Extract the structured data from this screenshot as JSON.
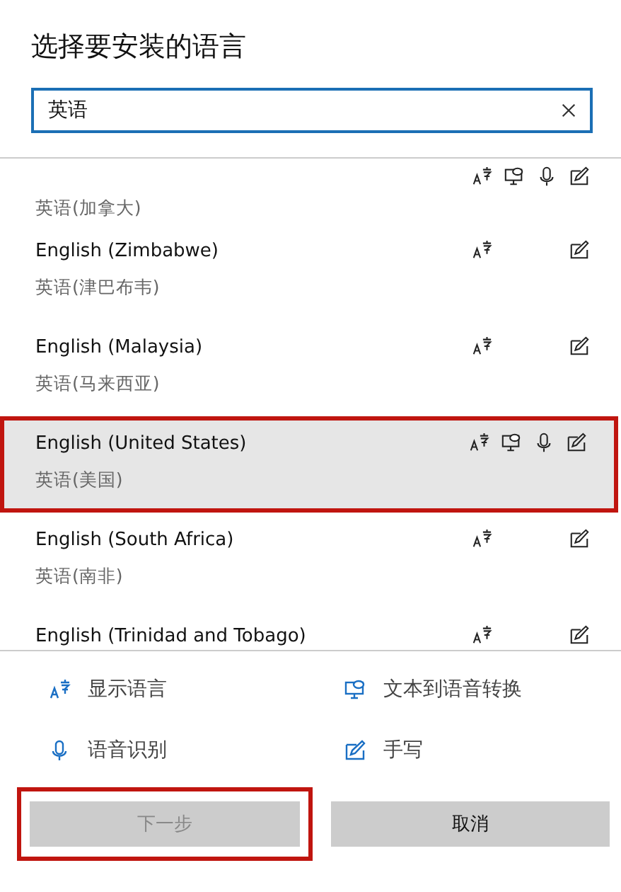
{
  "title": "选择要安装的语言",
  "search": {
    "value": "英语"
  },
  "languages": [
    {
      "native": "英语(加拿大)",
      "display": true,
      "tts": true,
      "speech": true,
      "handwriting": true,
      "selected": false
    },
    {
      "name": "English (Zimbabwe)",
      "native": "英语(津巴布韦)",
      "display": true,
      "tts": false,
      "speech": false,
      "handwriting": true,
      "selected": false
    },
    {
      "name": "English (Malaysia)",
      "native": "英语(马来西亚)",
      "display": true,
      "tts": false,
      "speech": false,
      "handwriting": true,
      "selected": false
    },
    {
      "name": "English (United States)",
      "native": "英语(美国)",
      "display": true,
      "tts": true,
      "speech": true,
      "handwriting": true,
      "selected": true
    },
    {
      "name": "English (South Africa)",
      "native": "英语(南非)",
      "display": true,
      "tts": false,
      "speech": false,
      "handwriting": true,
      "selected": false
    },
    {
      "name": "English (Trinidad and Tobago)",
      "display": true,
      "tts": false,
      "speech": false,
      "handwriting": true,
      "selected": false
    }
  ],
  "legend": [
    {
      "kind": "display",
      "label": "显示语言"
    },
    {
      "kind": "tts",
      "label": "文本到语音转换"
    },
    {
      "kind": "speech",
      "label": "语音识别"
    },
    {
      "kind": "handwriting",
      "label": "手写"
    }
  ],
  "buttons": [
    {
      "label": "下一步",
      "disabled": true,
      "highlighted": true
    },
    {
      "label": "取消",
      "disabled": false,
      "highlighted": false
    }
  ]
}
